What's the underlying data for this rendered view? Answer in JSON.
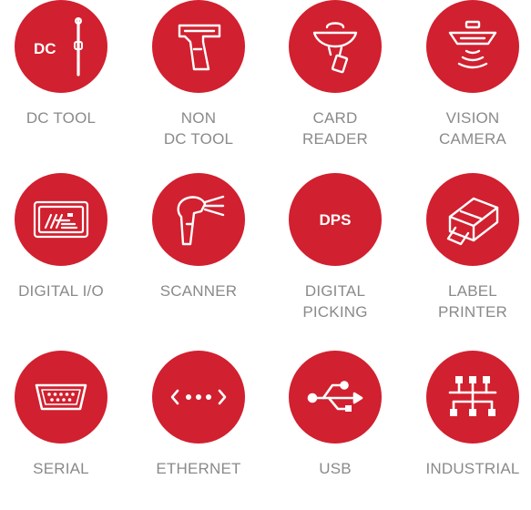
{
  "brand_color": "#d1202f",
  "text_color": "#8a8a8a",
  "items": [
    {
      "icon": "dc-tool-icon",
      "lines": [
        "DC TOOL"
      ],
      "badge": "DC"
    },
    {
      "icon": "non-dc-tool-icon",
      "lines": [
        "NON",
        "DC TOOL"
      ]
    },
    {
      "icon": "card-reader-icon",
      "lines": [
        "CARD",
        "READER"
      ]
    },
    {
      "icon": "vision-camera-icon",
      "lines": [
        "VISION",
        "CAMERA"
      ]
    },
    {
      "icon": "digital-io-icon",
      "lines": [
        "DIGITAL I/O"
      ]
    },
    {
      "icon": "scanner-icon",
      "lines": [
        "SCANNER"
      ]
    },
    {
      "icon": "digital-picking-icon",
      "lines": [
        "DIGITAL",
        "PICKING"
      ],
      "badge": "DPS"
    },
    {
      "icon": "label-printer-icon",
      "lines": [
        "LABEL",
        "PRINTER"
      ]
    },
    {
      "icon": "serial-icon",
      "lines": [
        "SERIAL"
      ]
    },
    {
      "icon": "ethernet-icon",
      "lines": [
        "ETHERNET"
      ]
    },
    {
      "icon": "usb-icon",
      "lines": [
        "USB"
      ]
    },
    {
      "icon": "industrial-icon",
      "lines": [
        "INDUSTRIAL"
      ]
    }
  ]
}
